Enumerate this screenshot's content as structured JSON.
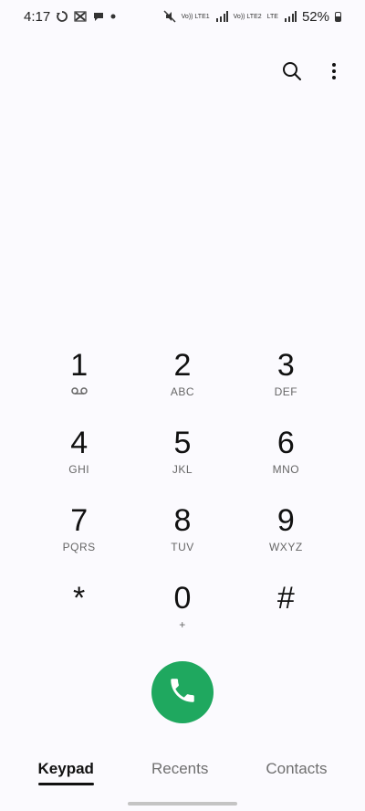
{
  "status_bar": {
    "time": "4:17",
    "network_labels": [
      "Vo)) LTE1",
      "Vo)) LTE2",
      "LTE"
    ],
    "battery": "52%"
  },
  "top_actions": {
    "search_icon": "search-icon",
    "more_icon": "more-vertical-icon"
  },
  "keypad": {
    "keys": [
      {
        "digit": "1",
        "sub": "ㅇㅇ"
      },
      {
        "digit": "2",
        "sub": "ABC"
      },
      {
        "digit": "3",
        "sub": "DEF"
      },
      {
        "digit": "4",
        "sub": "GHI"
      },
      {
        "digit": "5",
        "sub": "JKL"
      },
      {
        "digit": "6",
        "sub": "MNO"
      },
      {
        "digit": "7",
        "sub": "PQRS"
      },
      {
        "digit": "8",
        "sub": "TUV"
      },
      {
        "digit": "9",
        "sub": "WXYZ"
      },
      {
        "digit": "*",
        "sub": ""
      },
      {
        "digit": "0",
        "sub": "+"
      },
      {
        "digit": "#",
        "sub": ""
      }
    ]
  },
  "call_button": {
    "icon": "phone-icon",
    "color": "#1fa85f"
  },
  "tabs": [
    {
      "label": "Keypad",
      "active": true
    },
    {
      "label": "Recents",
      "active": false
    },
    {
      "label": "Contacts",
      "active": false
    }
  ]
}
